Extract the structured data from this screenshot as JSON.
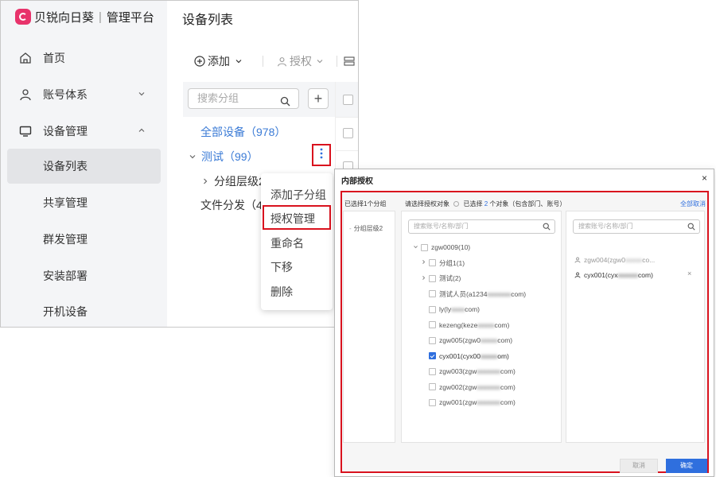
{
  "brand": {
    "name": "贝锐向日葵",
    "separator": "|",
    "subtitle": "管理平台",
    "logo_icon": "sunflower-logo"
  },
  "sidebar": {
    "items": [
      {
        "label": "首页",
        "icon": "home-icon"
      },
      {
        "label": "账号体系",
        "icon": "user-icon",
        "chevron": "chevron-down-icon"
      },
      {
        "label": "设备管理",
        "icon": "monitor-icon",
        "chevron": "chevron-up-icon"
      },
      {
        "label": "设备列表",
        "active": true
      },
      {
        "label": "共享管理"
      },
      {
        "label": "群发管理"
      },
      {
        "label": "安装部署"
      },
      {
        "label": "开机设备"
      }
    ]
  },
  "main": {
    "title": "设备列表",
    "toolbar": {
      "add_label": "添加",
      "auth_label": "授权"
    },
    "search_placeholder": "搜索分组",
    "add_group_symbol": "+"
  },
  "groups": {
    "all": "全部设备（978）",
    "test": "测试（99）",
    "level2": "分组层级2",
    "filedist": "文件分发（4"
  },
  "context_menu": {
    "items": [
      "添加子分组",
      "授权管理",
      "重命名",
      "下移",
      "删除"
    ],
    "highlighted": "授权管理"
  },
  "dialog": {
    "title": "内部授权",
    "selected_groups_text": "已选择1个分组",
    "group_item": "分组层级2",
    "instruction": "请选择授权对象",
    "selected_prefix": "已选择",
    "selected_count": "2",
    "selected_suffix": "个对象（包含部门、账号）",
    "clear_all": "全部取消",
    "search_placeholder": "搜索账号/名称/部门",
    "tree": [
      {
        "text": "zgw0009(10)",
        "arrow": "v",
        "level": 0
      },
      {
        "text": "分组1(1)",
        "arrow": ">",
        "level": 1
      },
      {
        "text": "测试(2)",
        "arrow": ">",
        "level": 1
      },
      {
        "text": "测试人员(a1234",
        "blur": "xxxxxxx",
        "tail": "com)",
        "level": 1
      },
      {
        "text": "ly(ly",
        "blur": "xxxx",
        "tail": "com)",
        "level": 1
      },
      {
        "text": "kezeng(keze",
        "blur": "xxxxx",
        "tail": "com)",
        "level": 1
      },
      {
        "text": "zgw005(zgw0",
        "blur": "xxxxx",
        "tail": "com)",
        "level": 1
      },
      {
        "text": "cyx001(cyx00",
        "blur": "xxxxx",
        "tail": "om)",
        "level": 1,
        "checked": true
      },
      {
        "text": "zgw003(zgw",
        "blur": "xxxxxxx",
        "tail": "com)",
        "level": 1
      },
      {
        "text": "zgw002(zgw",
        "blur": "xxxxxxx",
        "tail": "com)",
        "level": 1
      },
      {
        "text": "zgw001(zgw",
        "blur": "xxxxxxx",
        "tail": "com)",
        "level": 1
      }
    ],
    "selected": [
      {
        "text": "zgw004(zgw0",
        "blur": "xxxxx",
        "tail": "co...",
        "removable": false
      },
      {
        "text": "cyx001(cyx",
        "blur": "xxxxxx",
        "tail": "com)",
        "removable": true
      }
    ],
    "remove_symbol": "×",
    "close_symbol": "×",
    "cancel_label": "取消",
    "ok_label": "确定"
  },
  "colors": {
    "accent": "#2f6fde",
    "highlight": "#d9121e",
    "link": "#3b7bd6",
    "sidebar_bg": "#f4f5f7"
  }
}
